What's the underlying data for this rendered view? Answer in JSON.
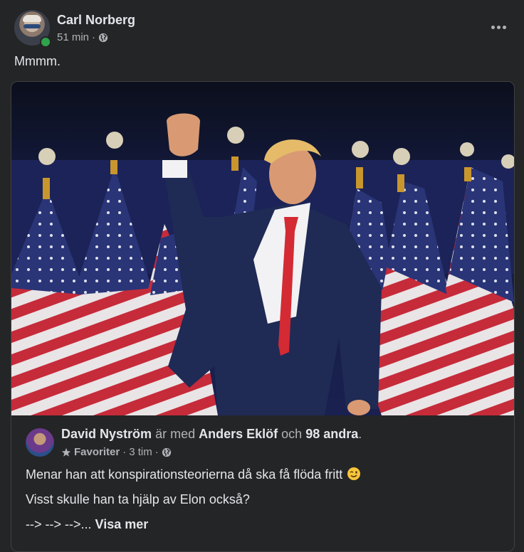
{
  "post": {
    "author": "Carl Norberg",
    "time": "51 min",
    "separator": "·",
    "text": "Mmmm."
  },
  "shared": {
    "author": "David Nyström",
    "with_word": "är med",
    "tagged": "Anders Eklöf",
    "and_word": "och",
    "others": "98 andra",
    "period": ".",
    "favorites": "Favoriter",
    "time": "3 tim",
    "sep": "·",
    "line1": "Menar han att konspirationsteorierna då ska få flöda fritt",
    "line2": "Visst skulle han ta hjälp av Elon också?",
    "line3": "--> --> -->...",
    "see_more": "Visa mer"
  },
  "colors": {
    "background": "#242526",
    "text_primary": "#e4e6eb",
    "text_secondary": "#b0b3b8",
    "online": "#31a24c"
  },
  "icons": {
    "globe": "globe-icon",
    "star": "star-icon",
    "more": "more-horizontal-icon",
    "emoji": "winking-face-icon"
  }
}
